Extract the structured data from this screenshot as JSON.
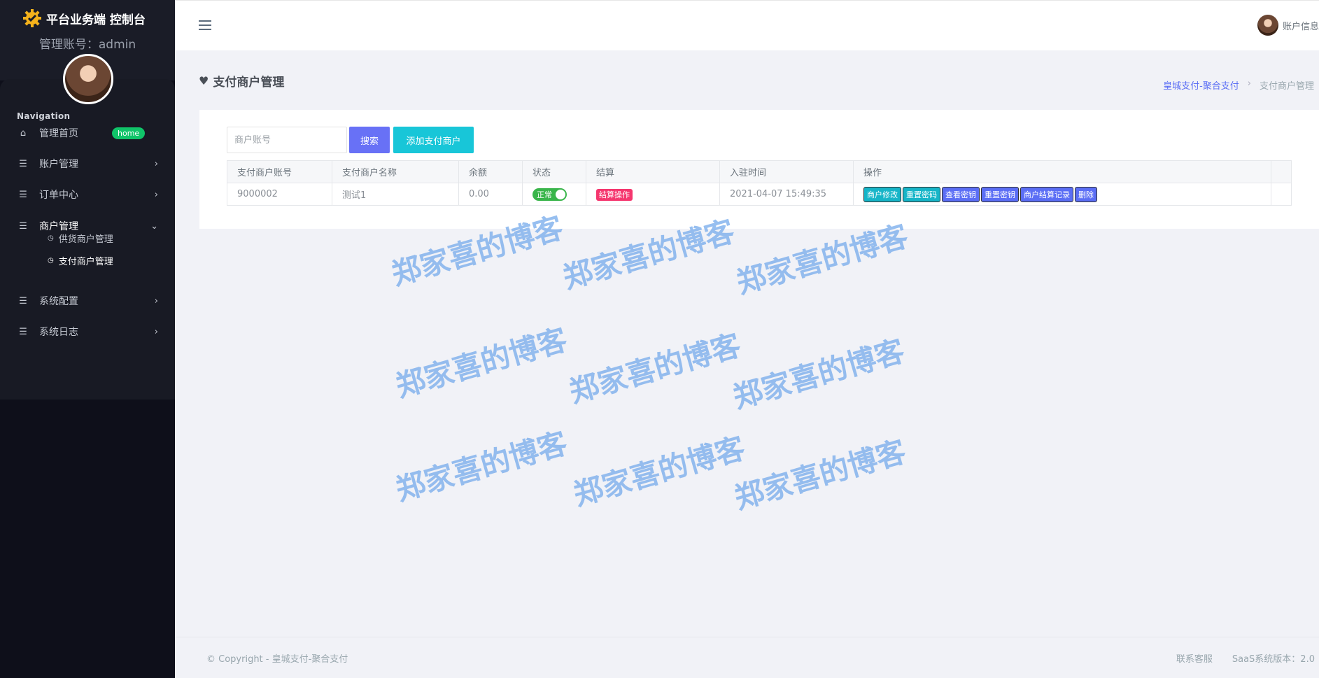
{
  "brand": {
    "title": "平台业务端 控制台",
    "admin_account": "管理账号：admin"
  },
  "sidebar": {
    "heading": "Navigation",
    "items": [
      {
        "label": "管理首页",
        "badge": "home",
        "icon": "home-icon"
      },
      {
        "label": "账户管理",
        "icon": "list-icon"
      },
      {
        "label": "订单中心",
        "icon": "list-icon"
      },
      {
        "label": "商户管理",
        "icon": "list-icon"
      },
      {
        "label": "系统配置",
        "icon": "list-icon"
      },
      {
        "label": "系统日志",
        "icon": "list-icon"
      }
    ],
    "sub_items": [
      {
        "label": "供货商户管理"
      },
      {
        "label": "支付商户管理"
      }
    ]
  },
  "topbar": {
    "account_label": "账户信息"
  },
  "page": {
    "title": "支付商户管理",
    "breadcrumb": {
      "link": "皇城支付-聚合支付",
      "current": "支付商户管理"
    }
  },
  "search": {
    "placeholder": "商户账号",
    "search_label": "搜索",
    "add_label": "添加支付商户"
  },
  "table": {
    "headers": [
      "支付商户账号",
      "支付商户名称",
      "余额",
      "状态",
      "结算",
      "入驻时间",
      "操作"
    ],
    "rows": [
      {
        "account": "9000002",
        "name": "测试1",
        "balance": "0.00",
        "status": "正常",
        "settle": "结算操作",
        "joined": "2021-04-07 15:49:35",
        "actions": [
          "商户修改",
          "重置密码",
          "查看密钥",
          "重置密钥",
          "商户结算记录",
          "删除"
        ]
      }
    ]
  },
  "watermark": "郑家喜的博客",
  "footer": {
    "copyright": "© Copyright - 皇城支付-聚合支付",
    "service": "联系客服",
    "version": "SaaS系统版本：2.0"
  }
}
